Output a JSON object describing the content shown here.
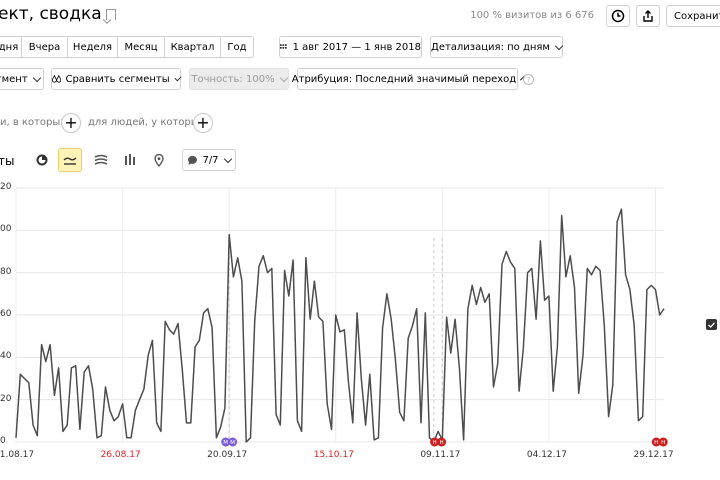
{
  "header": {
    "title": "ект, сводка",
    "visits_text": "100 % визитов из 6 676",
    "save_label": "Сохранить"
  },
  "period_tabs": [
    "дня",
    "Вчера",
    "Неделя",
    "Месяц",
    "Квартал",
    "Год"
  ],
  "date_range": "1 авг 2017 — 1 янв 2018",
  "detail_label": "Детализация: по дням",
  "segment_label": "гмент",
  "compare_label": "Сравнить сегменты",
  "accuracy_label": "Точность: 100%",
  "attribution_label": "Атрибуция: Последний значимый переход",
  "filters": {
    "left_text": "и, в которых",
    "right_text": "для людей, у которых",
    "plus": "+"
  },
  "chart_toolbar": {
    "label": "ты",
    "metrics_count": "7/7"
  },
  "chart_data": {
    "type": "line",
    "ylim": [
      0,
      120
    ],
    "y_ticks": [
      "20",
      "00",
      "80",
      "60",
      "40",
      "20",
      "0"
    ],
    "x_labels": [
      {
        "text": "01.08.17",
        "weekend": false
      },
      {
        "text": "26.08.17",
        "weekend": true
      },
      {
        "text": "20.09.17",
        "weekend": false
      },
      {
        "text": "15.10.17",
        "weekend": true
      },
      {
        "text": "09.11.17",
        "weekend": false
      },
      {
        "text": "04.12.17",
        "weekend": false
      },
      {
        "text": "29.12.17",
        "weekend": false
      }
    ],
    "series": [
      {
        "color": "#4d4d4d",
        "x": [
          1,
          2,
          3,
          4,
          5,
          6,
          7,
          8,
          9,
          10,
          11,
          12,
          13,
          14,
          15,
          16,
          17,
          18,
          19,
          20,
          21,
          22,
          23,
          24,
          25,
          26,
          27,
          28,
          29,
          30,
          31,
          32,
          33,
          34,
          35,
          36,
          37,
          38,
          39,
          40,
          41,
          42,
          43,
          44,
          45,
          46,
          47,
          48,
          49,
          50,
          51,
          52,
          53,
          54,
          55,
          56,
          57,
          58,
          59,
          60,
          61,
          62,
          63,
          64,
          65,
          66,
          67,
          68,
          69,
          70,
          71,
          72,
          73,
          74,
          75,
          76,
          77,
          78,
          79,
          80,
          81,
          82,
          83,
          84,
          85,
          86,
          87,
          88,
          89,
          90,
          91,
          92,
          93,
          94,
          95,
          96,
          97,
          98,
          99,
          100,
          101,
          102,
          103,
          104,
          105,
          106,
          107,
          108,
          109,
          110,
          111,
          112,
          113,
          114,
          115,
          116,
          117,
          118,
          119,
          120,
          121,
          122,
          123,
          124,
          125,
          126,
          127,
          128,
          129,
          130,
          131,
          132,
          133,
          134,
          135,
          136,
          137,
          138,
          139,
          140,
          141,
          142,
          143,
          144,
          145,
          146,
          147,
          148,
          149,
          150,
          151,
          152,
          153
        ],
        "values": [
          2,
          32,
          30,
          28,
          8,
          3,
          46,
          38,
          46,
          22,
          35,
          5,
          8,
          35,
          36,
          6,
          33,
          36,
          25,
          2,
          3,
          26,
          15,
          10,
          12,
          18,
          2,
          2,
          15,
          20,
          25,
          41,
          48,
          9,
          5,
          57,
          53,
          51,
          56,
          34,
          9,
          9,
          45,
          48,
          61,
          63,
          54,
          2,
          7,
          16,
          98,
          78,
          87,
          76,
          0,
          2,
          57,
          83,
          88,
          80,
          82,
          13,
          8,
          81,
          69,
          86,
          10,
          5,
          87,
          58,
          76,
          59,
          57,
          18,
          6,
          60,
          52,
          53,
          28,
          9,
          61,
          30,
          8,
          32,
          1,
          2,
          54,
          70,
          58,
          39,
          14,
          10,
          49,
          55,
          63,
          9,
          61,
          2,
          0,
          5,
          1,
          59,
          42,
          58,
          35,
          1,
          63,
          74,
          65,
          73,
          66,
          70,
          26,
          37,
          84,
          90,
          85,
          82,
          24,
          44,
          80,
          82,
          58,
          95,
          67,
          69,
          24,
          45,
          107,
          78,
          88,
          73,
          23,
          41,
          82,
          79,
          83,
          81,
          55,
          12,
          27,
          104,
          110,
          79,
          72,
          55,
          10,
          12,
          72,
          74,
          72,
          60,
          63
        ],
        "markers": [
          {
            "label": "M",
            "color": "#7b5fd6",
            "x": 51
          },
          {
            "label": "H",
            "color": "#cc1f1f",
            "x": 100
          },
          {
            "label": "H",
            "color": "#cc1f1f",
            "x": 152
          }
        ]
      }
    ]
  }
}
